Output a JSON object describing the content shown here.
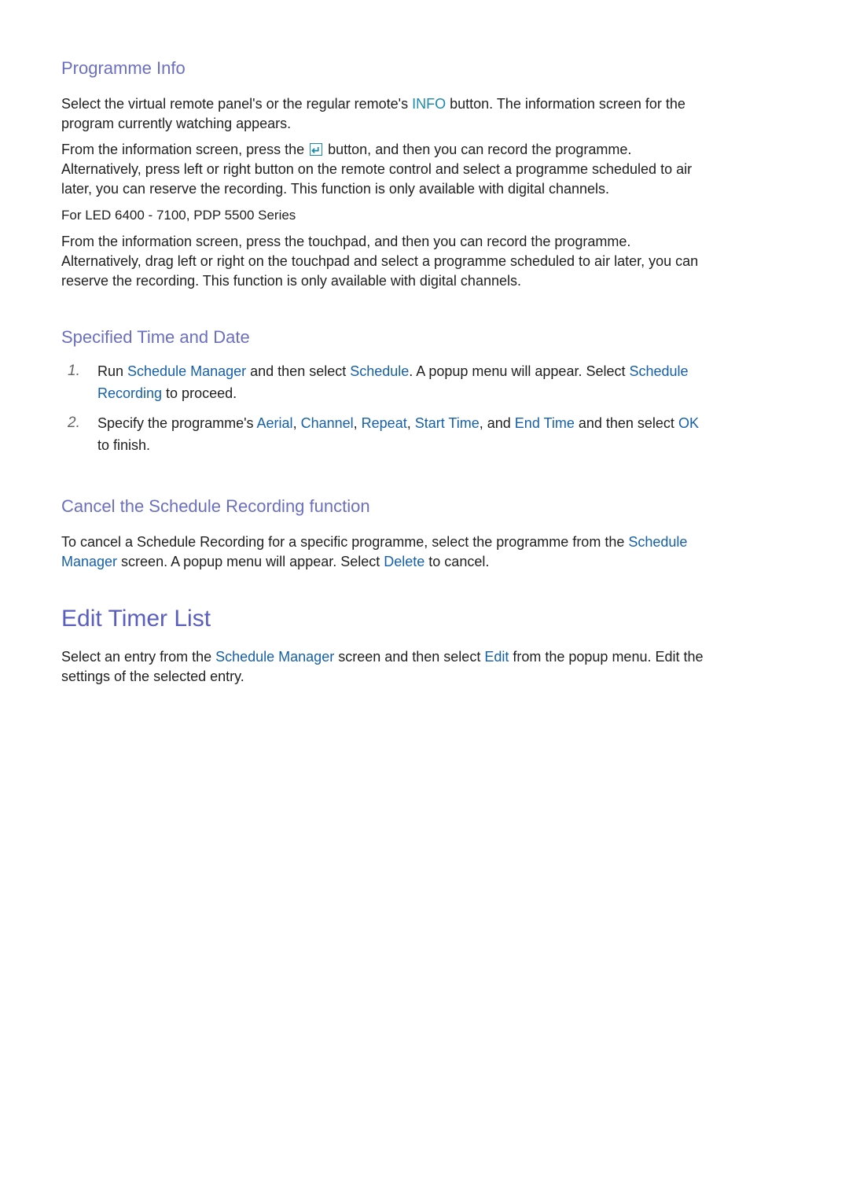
{
  "colors": {
    "heading": "#6b6fc2",
    "title": "#5a5ebf",
    "keyword": "#1560a8",
    "info_keyword": "#1a8aa8",
    "text": "#1f1f1f"
  },
  "programme_info": {
    "heading": "Programme Info",
    "p1": [
      "Select  the virtual remote panel's or the regular remote's ",
      "INFO",
      " button. The information screen for the",
      "program currently watching appears."
    ],
    "p2": [
      "From the information screen, press the ",
      "enter-icon",
      " button, and then you can record the programme.",
      "Alternatively, press left or right button on the remote control and select a programme scheduled to air",
      "later, you can reserve the recording. This function is only available with digital channels."
    ],
    "subheading": "For LED 6400 - 7100, PDP 5500 Series",
    "p3": [
      "From the information screen, press the touchpad, and then you can record the programme.",
      "Alternatively, drag left or right on the touchpad and select a programme scheduled to air later, you can",
      "reserve the recording. This function is only available with digital channels."
    ]
  },
  "specified_time": {
    "heading": "Specified Time and Date",
    "steps": [
      {
        "num": "1.",
        "parts": [
          "Run ",
          "Schedule Manager",
          " and then select ",
          "Schedule",
          ". A popup menu will appear. Select ",
          "Schedule",
          "Recording",
          " to proceed."
        ]
      },
      {
        "num": "2.",
        "parts": [
          "Specify the programme's ",
          "Aerial",
          ", ",
          "Channel",
          ", ",
          "Repeat",
          ", ",
          "Start Time",
          ", and ",
          "End Time",
          " and then select ",
          "OK",
          "to finish."
        ]
      }
    ]
  },
  "cancel": {
    "heading": "Cancel the Schedule Recording function",
    "parts": [
      "To cancel a Schedule Recording for a specific programme, select the programme from the ",
      "Schedule",
      "Manager",
      " screen. A popup menu will appear. Select ",
      "Delete",
      " to cancel."
    ]
  },
  "edit_timer": {
    "title": "Edit Timer List",
    "parts": [
      "Select an entry from the ",
      "Schedule Manager",
      " screen and then select ",
      "Edit",
      " from the popup menu. Edit the",
      "settings of the selected entry."
    ]
  }
}
